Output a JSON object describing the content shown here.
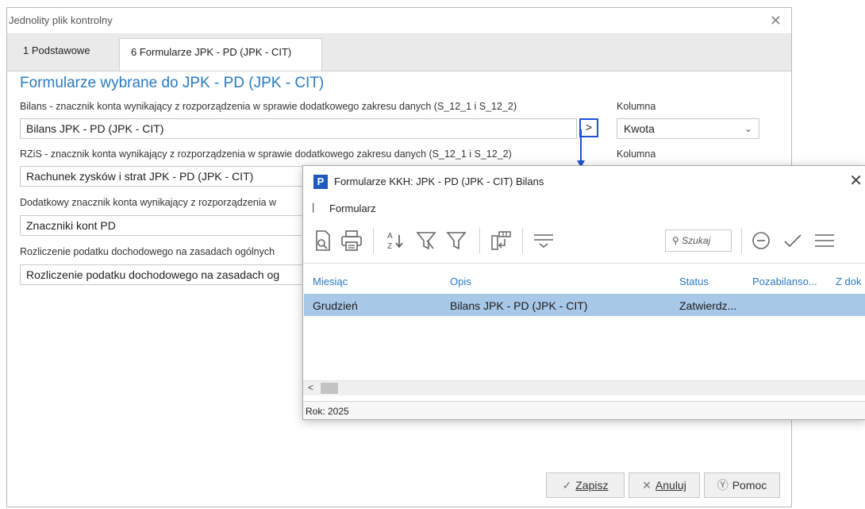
{
  "main_window": {
    "title": "Jednolity plik kontrolny",
    "close_glyph": "✕",
    "tabs": [
      {
        "label": "1 Podstawowe",
        "active": false
      },
      {
        "label": "6 Formularze JPK - PD (JPK - CIT)",
        "active": true
      }
    ],
    "section_heading": "Formularze wybrane do JPK - PD (JPK - CIT)",
    "fields": [
      {
        "label": "Bilans - znacznik konta wynikający z rozporządzenia w sprawie dodatkowego zakresu danych (S_12_1 i S_12_2)",
        "value": "Bilans JPK - PD (JPK - CIT)"
      },
      {
        "label": "RZiS - znacznik konta wynikający z rozporządzenia w sprawie dodatkowego zakresu danych (S_12_1 i S_12_2)",
        "value": "Rachunek zysków i strat JPK - PD (JPK - CIT)"
      },
      {
        "label": "Dodatkowy znacznik konta wynikający z rozporządzenia w",
        "value": "Znaczniki kont PD"
      },
      {
        "label": "Rozliczenie podatku dochodowego na zasadach ogólnych",
        "value": "Rozliczenie podatku dochodowego na zasadach og"
      }
    ],
    "column_label_1": "Kolumna",
    "column_label_2": "Kolumna",
    "column_select_value": "Kwota",
    "arrow_glyph": ">",
    "buttons": {
      "save": "Zapisz",
      "cancel": "Anuluj",
      "help": "Pomoc"
    },
    "highlight_color": "#2050d8"
  },
  "popup": {
    "logo_letter": "P",
    "title": "Formularze KKH: JPK - PD (JPK - CIT) Bilans",
    "close_glyph": "✕",
    "menu_separator": "|",
    "menu_item": "Formularz",
    "toolbar_icons": [
      "preview-icon",
      "print-icon",
      "sort-az-icon",
      "filter-clear-icon",
      "filter-icon",
      "columns-icon",
      "group-icon",
      "minus-circle-icon",
      "check-icon",
      "menu-icon"
    ],
    "search_placeholder": "Szukaj",
    "columns": [
      "Miesiąc",
      "Opis",
      "Status",
      "Pozabilanso...",
      "Z dok"
    ],
    "rows": [
      {
        "miesiac": "Grudzień",
        "opis": "Bilans JPK - PD (JPK - CIT)",
        "status": "Zatwierdz..."
      }
    ],
    "scroll_left_glyph": "<",
    "status_text": "Rok: 2025",
    "selected_row_color": "#a8c8e8",
    "header_color": "#2a7abf"
  }
}
